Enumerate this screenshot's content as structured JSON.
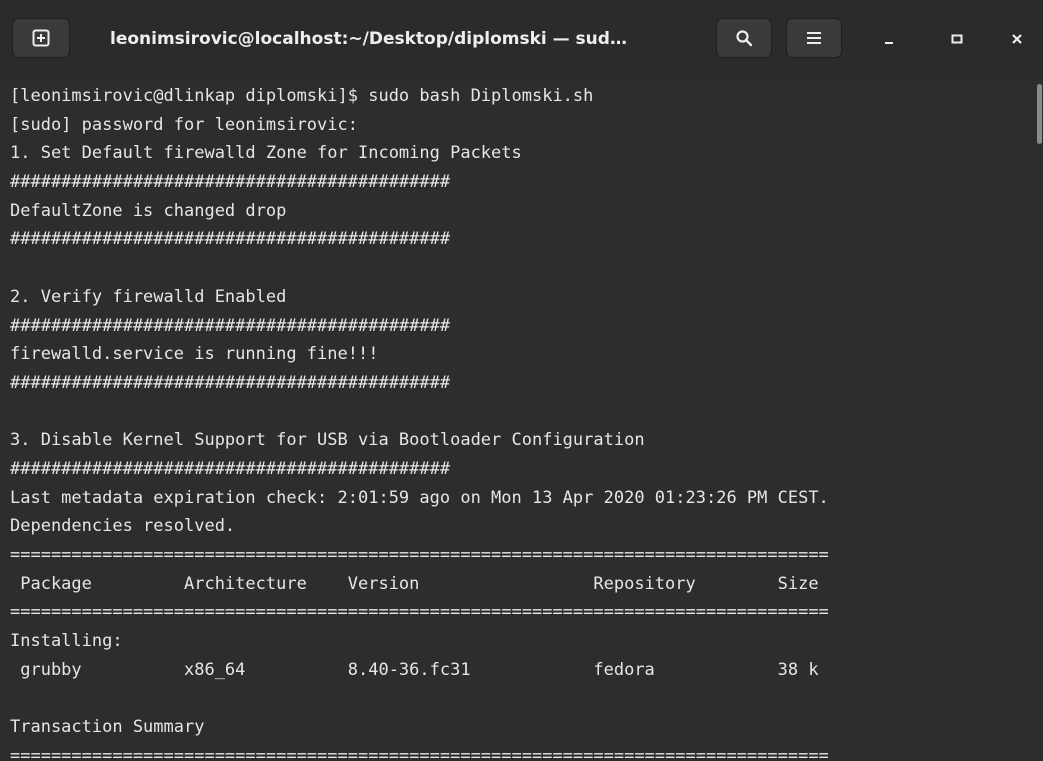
{
  "window": {
    "title": "leonimsirovic@localhost:~/Desktop/diplomski — sud…"
  },
  "terminal": {
    "lines": [
      "[leonimsirovic@dlinkap diplomski]$ sudo bash Diplomski.sh",
      "[sudo] password for leonimsirovic:",
      "1. Set Default firewalld Zone for Incoming Packets",
      "###########################################",
      "DefaultZone is changed drop",
      "###########################################",
      "",
      "2. Verify firewalld Enabled",
      "###########################################",
      "firewalld.service is running fine!!!",
      "###########################################",
      "",
      "3. Disable Kernel Support for USB via Bootloader Configuration",
      "###########################################",
      "Last metadata expiration check: 2:01:59 ago on Mon 13 Apr 2020 01:23:26 PM CEST.",
      "Dependencies resolved.",
      "================================================================================",
      " Package         Architecture    Version                 Repository        Size",
      "================================================================================",
      "Installing:",
      " grubby          x86_64          8.40-36.fc31            fedora            38 k",
      "",
      "Transaction Summary",
      "================================================================================"
    ]
  },
  "icons": {
    "new_tab": "new-tab-icon",
    "search": "search-icon",
    "menu": "hamburger-menu-icon",
    "minimize": "minimize-icon",
    "maximize": "maximize-icon",
    "close": "close-icon"
  },
  "colors": {
    "background": "#2d2d2d",
    "titlebar": "#2b2b2b",
    "text": "#e6e6e6"
  }
}
